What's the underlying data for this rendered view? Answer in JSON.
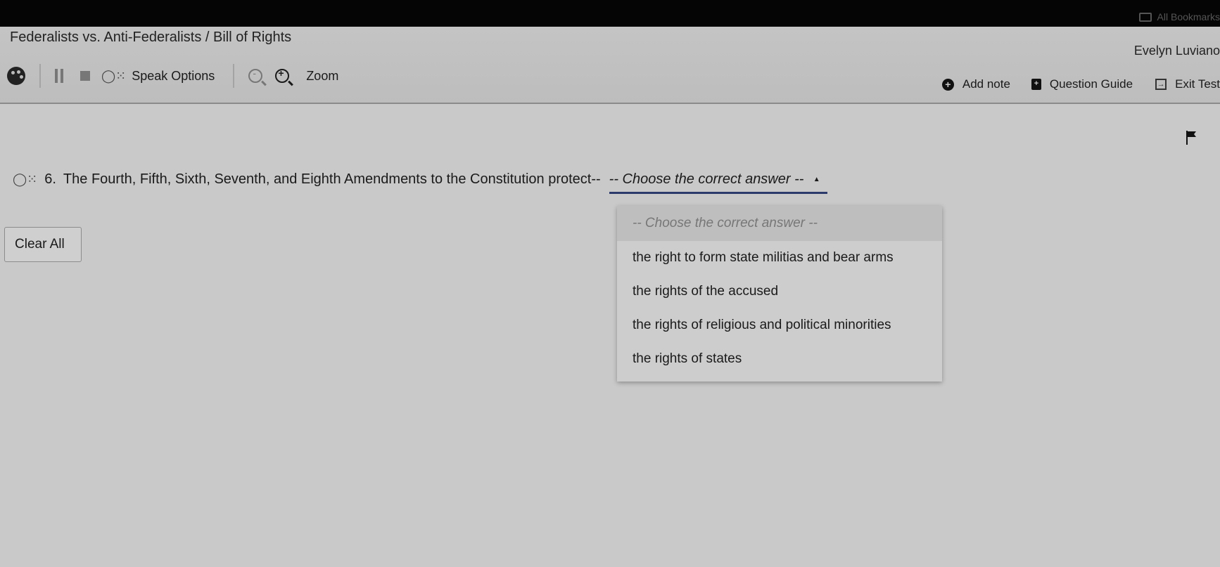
{
  "browser": {
    "bookmarks_label": "All Bookmarks"
  },
  "header": {
    "title": "Federalists vs. Anti-Federalists / Bill of Rights",
    "user_name": "Evelyn Luviano"
  },
  "toolbar": {
    "speak_options_label": "Speak Options",
    "zoom_label": "Zoom",
    "add_note_label": "Add note",
    "question_guide_label": "Question Guide",
    "exit_label": "Exit Test"
  },
  "question": {
    "number": "6.",
    "text": "The Fourth, Fifth, Sixth, Seventh, and Eighth Amendments to the Constitution protect--",
    "selected_value": "-- Choose the correct answer --",
    "options": [
      "-- Choose the correct answer --",
      "the right to form state militias and bear arms",
      "the rights of the accused",
      "the rights of religious and political minorities",
      "the rights of states"
    ]
  },
  "actions": {
    "clear_all_label": "Clear All"
  },
  "icons": {
    "palette": "palette-icon",
    "pause": "pause-icon",
    "stop": "stop-icon",
    "speak": "speak-icon",
    "zoom_out": "zoom-out-icon",
    "zoom_in": "zoom-in-icon",
    "add_note": "add-circle-icon",
    "question_guide": "question-guide-icon",
    "exit": "exit-icon",
    "flag": "flag-icon"
  }
}
